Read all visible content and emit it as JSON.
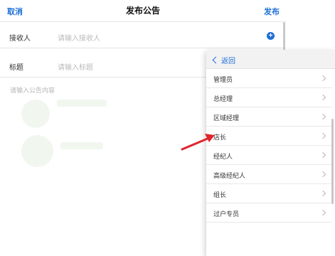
{
  "navbar": {
    "cancel_label": "取消",
    "title": "发布公告",
    "publish_label": "发布"
  },
  "form": {
    "recipient": {
      "label": "接收人",
      "placeholder": "请输入接收人"
    },
    "title": {
      "label": "标题",
      "placeholder": "请输入标题"
    },
    "content_placeholder": "请输入公告内容"
  },
  "dropdown": {
    "back_label": "返回",
    "items": [
      {
        "label": "管理员"
      },
      {
        "label": "总经理"
      },
      {
        "label": "区域经理"
      },
      {
        "label": "店长"
      },
      {
        "label": "经纪人"
      },
      {
        "label": "高级经纪人"
      },
      {
        "label": "组长"
      },
      {
        "label": "过户专员"
      }
    ]
  },
  "annotation": {
    "arrow_color": "#e0252b"
  },
  "colors": {
    "accent": "#1e6fd6"
  }
}
